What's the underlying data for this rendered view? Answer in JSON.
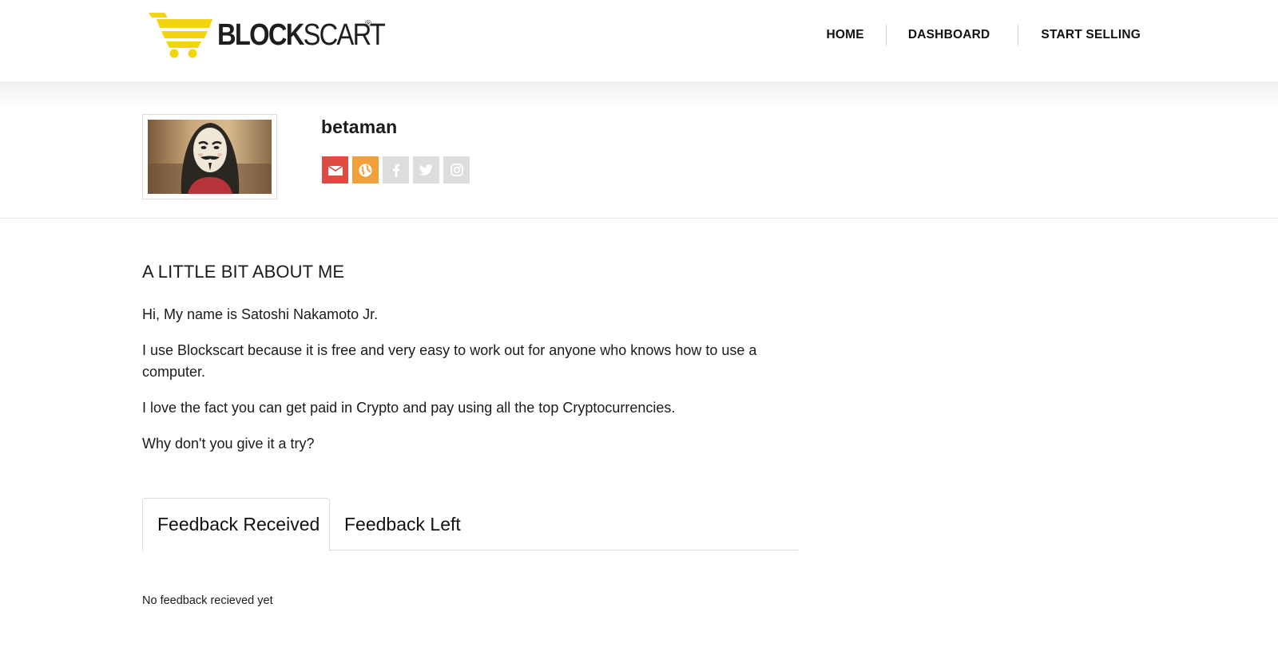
{
  "brand": {
    "logo_text_bold": "BLOCK",
    "logo_text_thin": "SCART",
    "logo_registered": "®",
    "logo_color": "#f2d40f"
  },
  "nav": {
    "items": [
      {
        "label": "HOME"
      },
      {
        "label": "DASHBOARD"
      },
      {
        "label": "START SELLING"
      }
    ]
  },
  "profile": {
    "username": "betaman",
    "avatar_icon": "masked-user-photo",
    "socials": [
      {
        "name": "email",
        "icon": "envelope-icon",
        "color": "#e04a42"
      },
      {
        "name": "website",
        "icon": "globe-icon",
        "color": "#f2a03c"
      },
      {
        "name": "facebook",
        "icon": "facebook-icon",
        "color": "#dddddd"
      },
      {
        "name": "twitter",
        "icon": "twitter-icon",
        "color": "#dddddd"
      },
      {
        "name": "instagram",
        "icon": "instagram-icon",
        "color": "#dddddd"
      }
    ]
  },
  "about": {
    "title": "A LITTLE BIT ABOUT ME",
    "paragraphs": [
      "Hi, My name is Satoshi Nakamoto Jr.",
      "I use Blockscart because it is free and very easy to work out for anyone who knows how to use a computer.",
      "I love the fact you can get paid in Crypto and pay using all the top Cryptocurrencies.",
      "Why don't you give it a try?"
    ]
  },
  "tabs": {
    "items": [
      {
        "label": "Feedback Received",
        "active": true
      },
      {
        "label": "Feedback Left",
        "active": false
      }
    ]
  },
  "feedback": {
    "empty_message": "No feedback recieved yet"
  }
}
